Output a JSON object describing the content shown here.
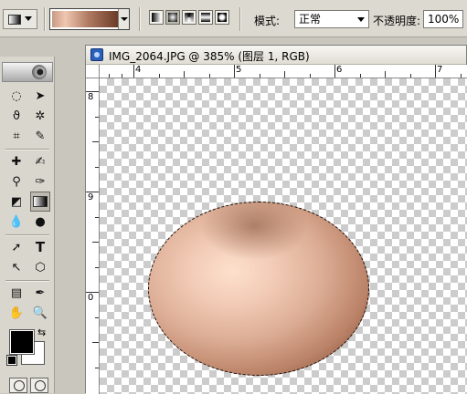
{
  "options_bar": {
    "mode_label": "模式:",
    "mode_value": "正常",
    "opacity_label": "不透明度:",
    "opacity_value": "100%",
    "gradient_types": [
      "linear-gradient-icon",
      "radial-gradient-icon",
      "angle-gradient-icon",
      "reflected-gradient-icon",
      "diamond-gradient-icon"
    ],
    "selected_gradient_type": "radial-gradient-icon"
  },
  "toolbox": {
    "tools": [
      [
        "marquee-icon",
        "move-icon"
      ],
      [
        "lasso-icon",
        "magic-wand-icon"
      ],
      [
        "crop-icon",
        "slice-icon"
      ],
      [
        "healing-brush-icon",
        "brush-icon"
      ],
      [
        "clone-stamp-icon",
        "history-brush-icon"
      ],
      [
        "eraser-icon",
        "gradient-icon"
      ],
      [
        "blur-icon",
        "dodge-icon"
      ],
      [
        "path-selection-icon",
        "type-icon"
      ],
      [
        "pen-icon",
        "shape-icon"
      ],
      [
        "notes-icon",
        "eyedropper-icon"
      ],
      [
        "hand-icon",
        "zoom-icon"
      ]
    ],
    "active_tool": "gradient-icon",
    "foreground_color": "#000000",
    "background_color": "#ffffff"
  },
  "document": {
    "title": "IMG_2064.JPG @ 385% (图层 1, RGB)",
    "h_ruler_labels": [
      "4",
      "5",
      "6",
      "7"
    ],
    "v_ruler_labels": [
      "8",
      "9",
      "0"
    ],
    "gradient_colors": [
      "#fde0cc",
      "#f2cbb6",
      "#ddae96",
      "#bb8368",
      "#6e3c26"
    ]
  }
}
